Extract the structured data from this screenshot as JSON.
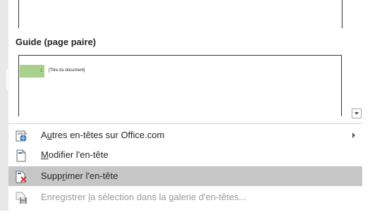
{
  "gallery": {
    "section_title": "Guide (page paire)",
    "thumbnail_text": "[Titre du document]"
  },
  "menu": {
    "items": [
      {
        "pre": "A",
        "accel": "u",
        "post": "tres en-têtes sur Office.com",
        "icon": "office-globe-icon",
        "has_submenu": true
      },
      {
        "pre": "",
        "accel": "M",
        "post": "odifier l'en-tête",
        "icon": "header-page-icon"
      },
      {
        "pre": "Supp",
        "accel": "r",
        "post": "imer l'en-tête",
        "icon": "remove-header-icon",
        "state": "highlighted"
      },
      {
        "pre": "Enregistrer ",
        "accel": "l",
        "post": "a sélection dans la galerie d'en-têtes...",
        "icon": "save-selection-icon",
        "state": "disabled"
      }
    ]
  },
  "colors": {
    "highlight": "#c6c6c6",
    "thumbnail_accent": "#a9d18e",
    "remove_red": "#d13438"
  }
}
